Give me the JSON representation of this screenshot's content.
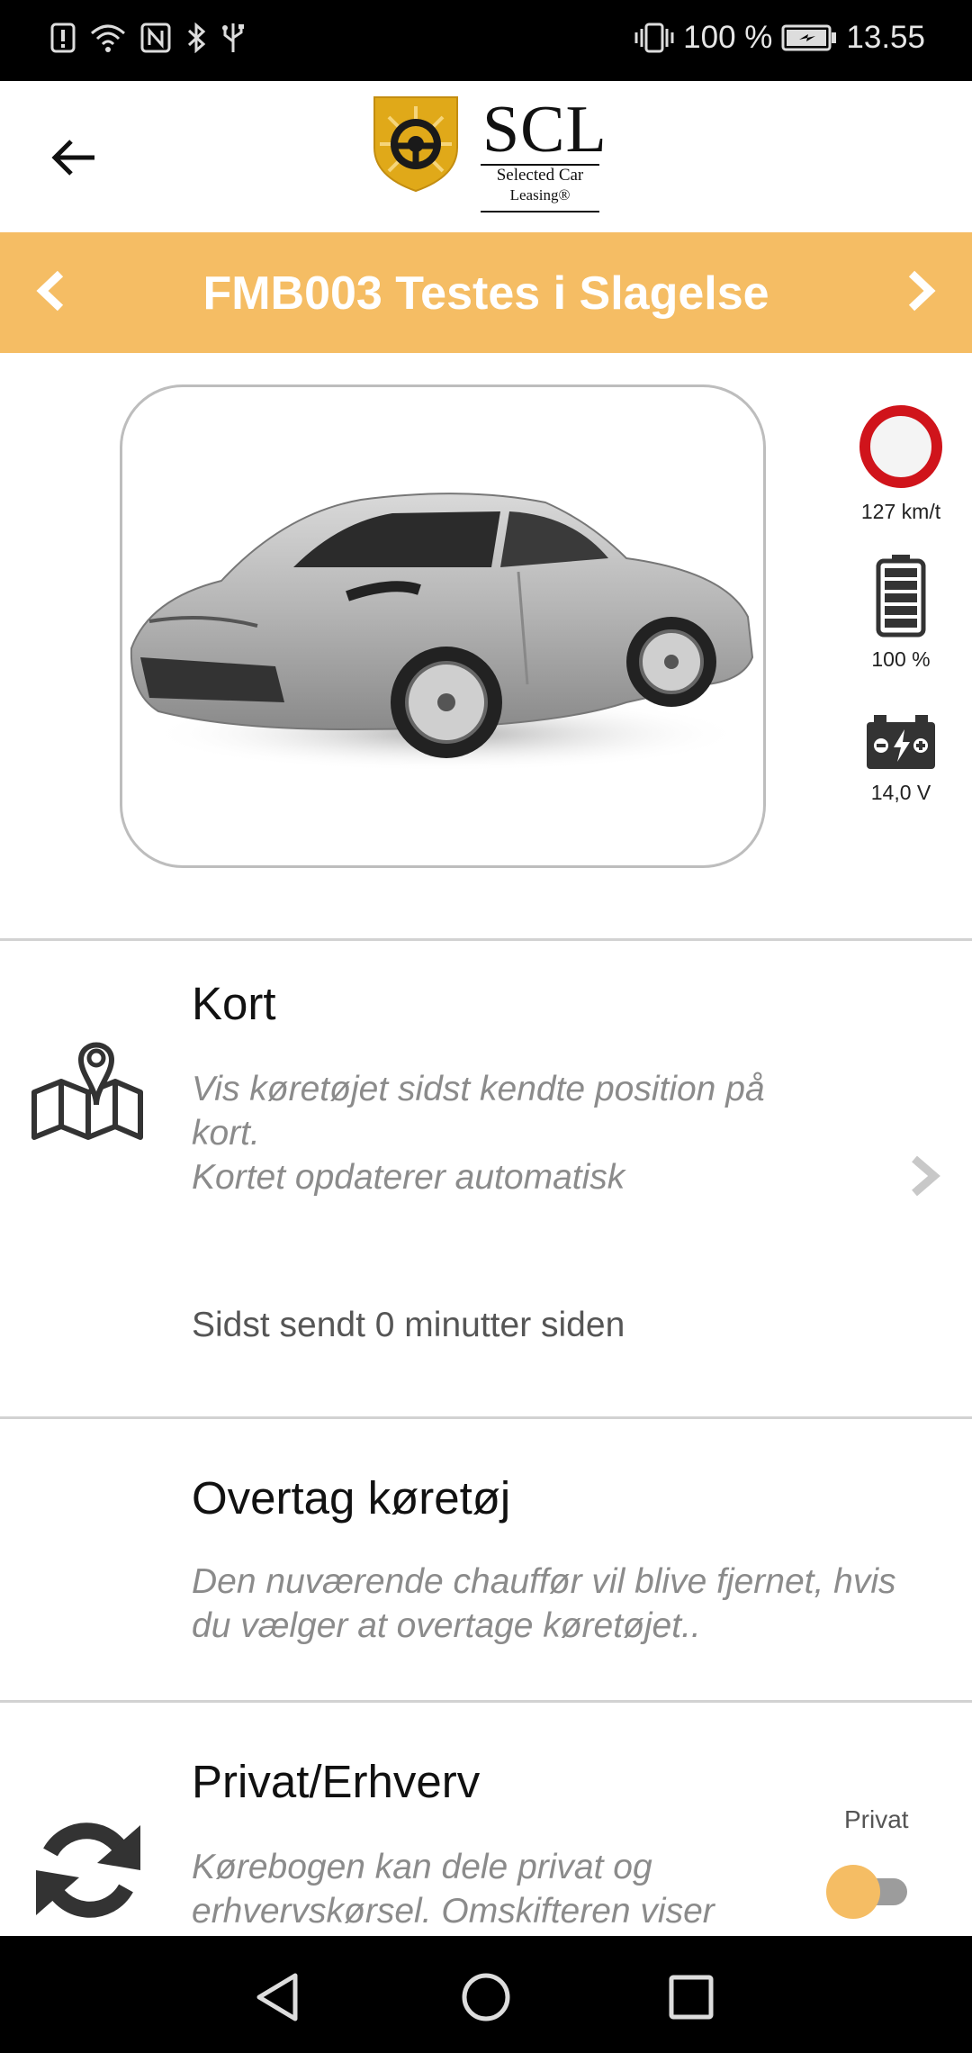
{
  "status_bar": {
    "battery_percent": "100 %",
    "time": "13.55",
    "icons": [
      "alert-icon",
      "wifi-icon",
      "nfc-icon",
      "bluetooth-icon",
      "usb-icon",
      "vibrate-icon",
      "battery-charging-icon"
    ]
  },
  "header": {
    "logo": {
      "title": "SCL",
      "subtitle_line1": "Selected Car",
      "subtitle_line2": "Leasing®"
    }
  },
  "vehicle": {
    "name": "FMB003 Testes i Slagelse"
  },
  "indicators": {
    "speed": "127 km/t",
    "battery": "100 %",
    "voltage": "14,0 V"
  },
  "sections": {
    "map": {
      "title": "Kort",
      "description_line1": "Vis køretøjet sidst kendte position på",
      "description_line2": "kort.",
      "description_line3": "Kortet opdaterer automatisk",
      "last_sent": "Sidst sendt 0 minutter siden"
    },
    "takeover": {
      "title": "Overtag køretøj",
      "description_line1": "Den nuværende chauffør vil blive fjernet, hvis",
      "description_line2": "du vælger at overtage køretøjet.."
    },
    "privat": {
      "title": "Privat/Erhverv",
      "description_line1": "Kørebogen kan dele privat og",
      "description_line2": "erhvervskørsel. Omskifteren viser",
      "toggle_label": "Privat"
    }
  },
  "colors": {
    "accent": "#f5bd64",
    "speed_ring": "#d0141b"
  }
}
